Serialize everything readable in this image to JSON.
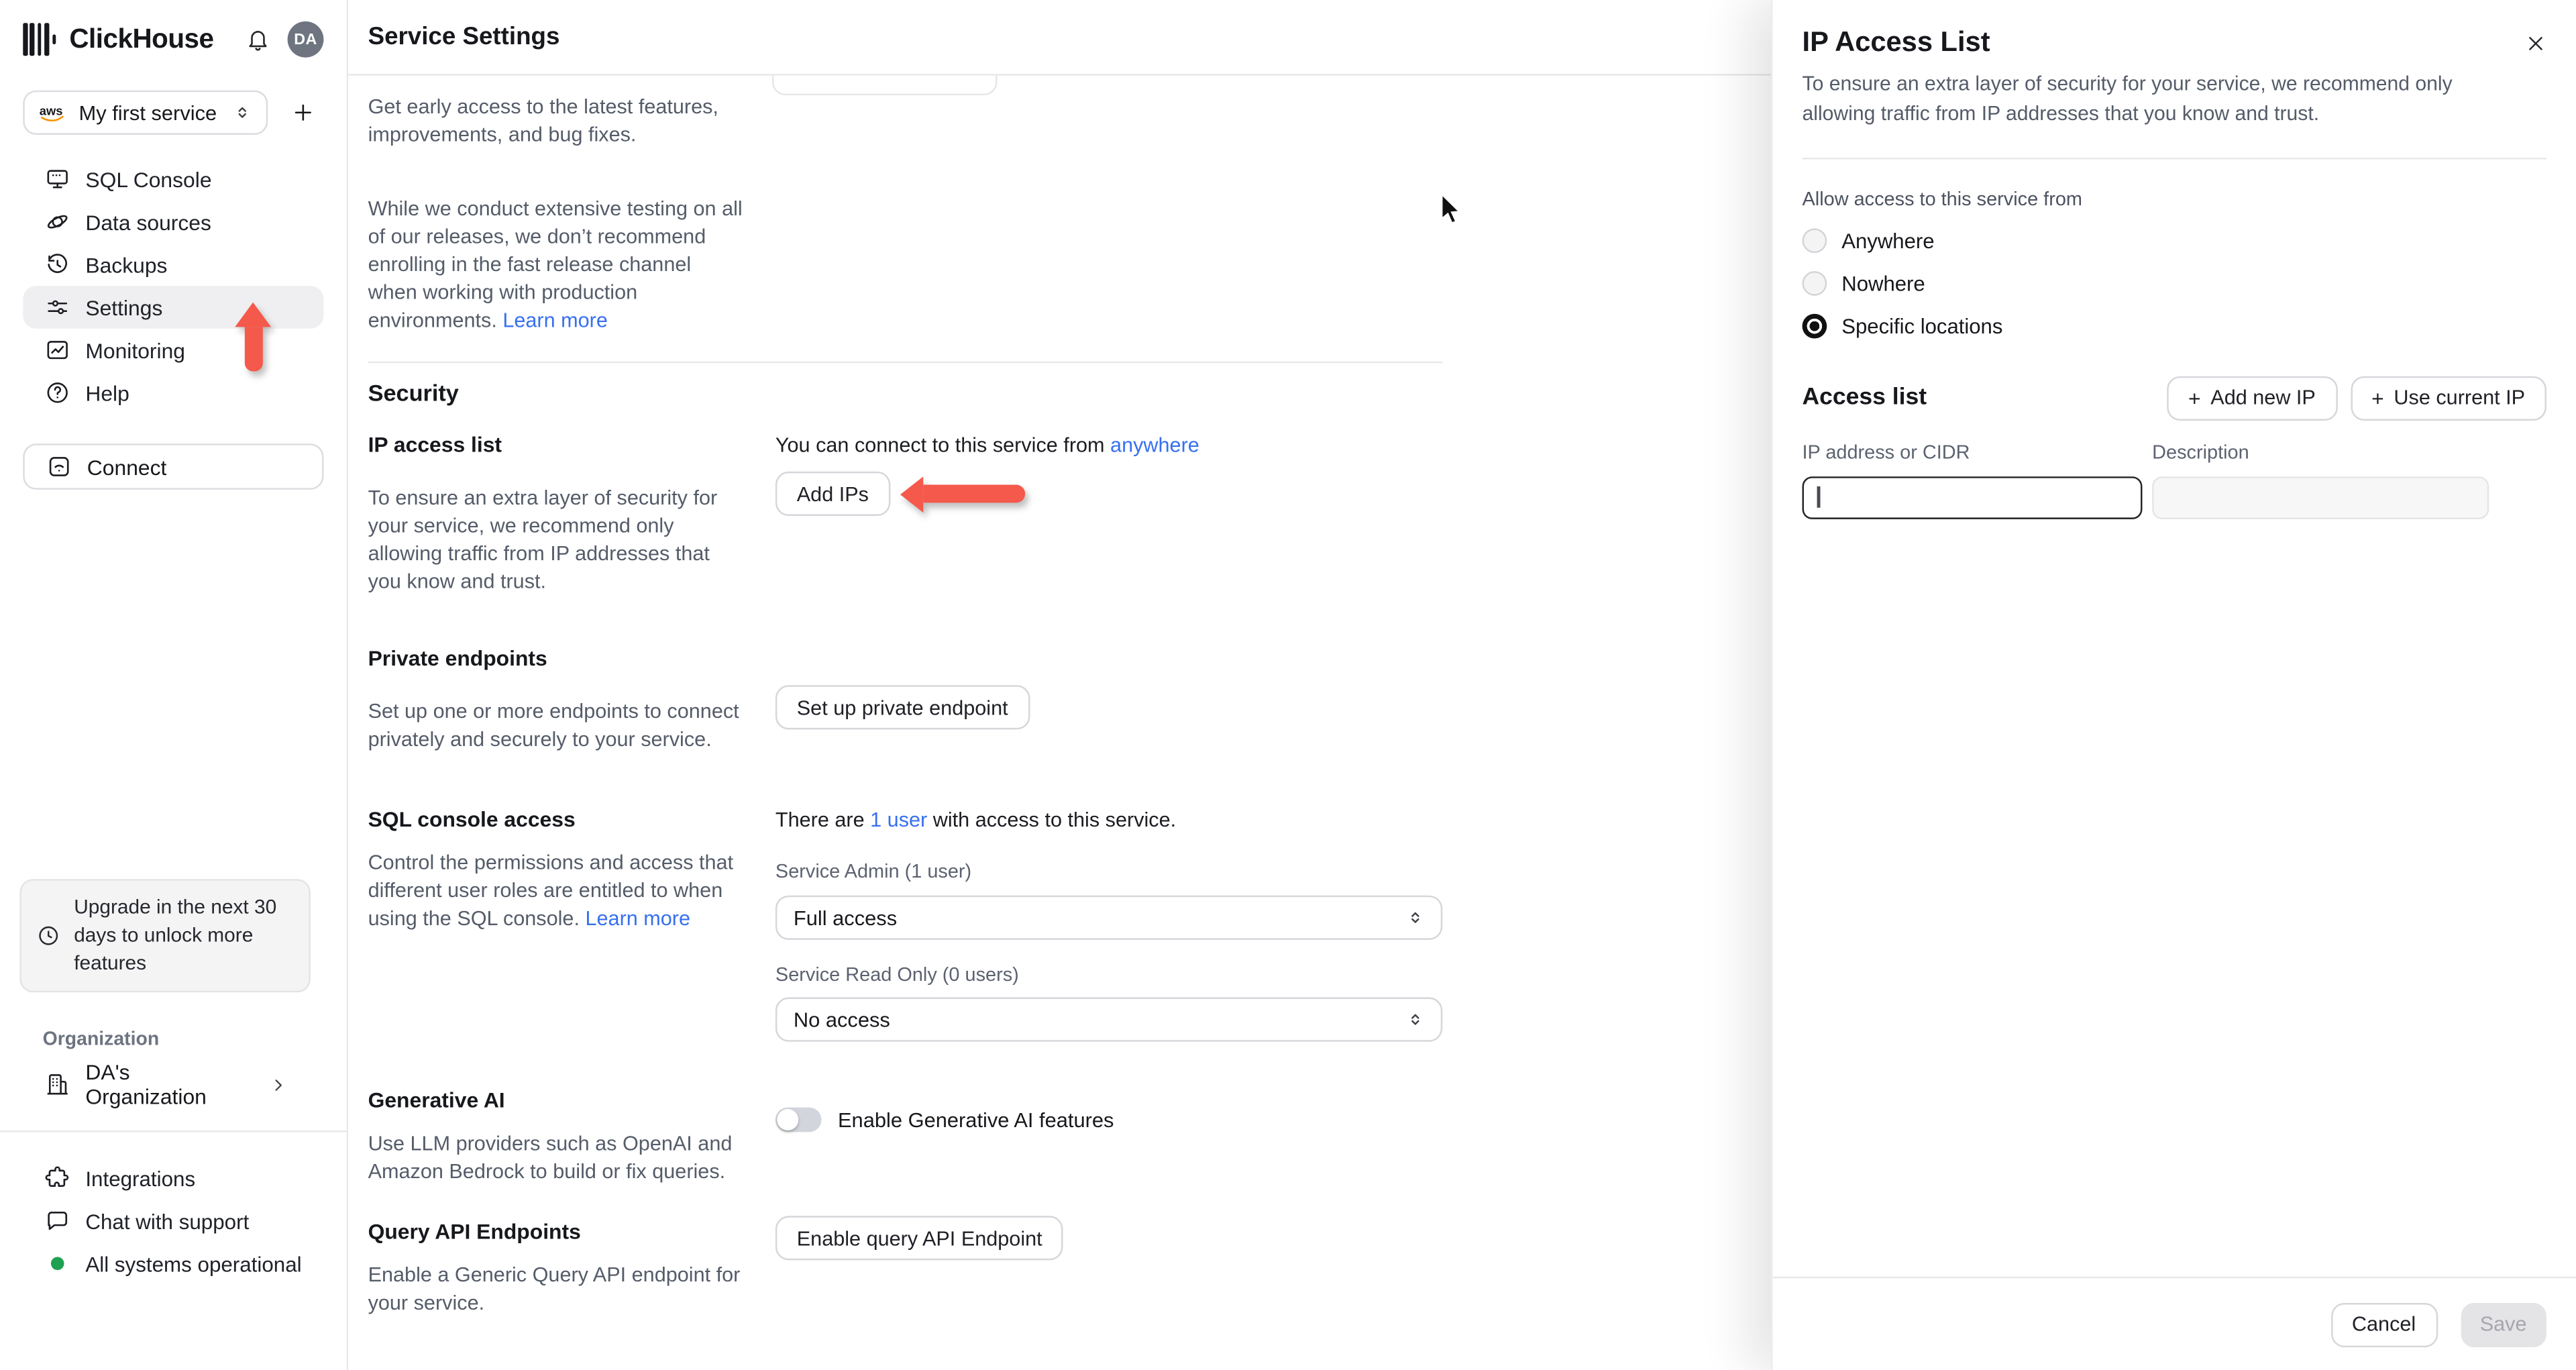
{
  "colors": {
    "accent_red": "#F4594C",
    "link_blue": "#3770EF",
    "status_green": "#1FA152"
  },
  "sidebar": {
    "brand": "ClickHouse",
    "avatar_initials": "DA",
    "service_selector": {
      "provider": "aws",
      "label": "My first service"
    },
    "add_service_label": "+",
    "nav": [
      {
        "label": "SQL Console"
      },
      {
        "label": "Data sources"
      },
      {
        "label": "Backups"
      },
      {
        "label": "Settings"
      },
      {
        "label": "Monitoring"
      },
      {
        "label": "Help"
      }
    ],
    "connect_label": "Connect",
    "upgrade_notice": "Upgrade in the next 30 days to unlock more features",
    "organization_label": "Organization",
    "organization_name": "DA's Organization",
    "footer_items": [
      {
        "label": "Integrations"
      },
      {
        "label": "Chat with support"
      },
      {
        "label": "All systems operational"
      }
    ]
  },
  "main": {
    "header_title": "Service Settings",
    "fast_release": {
      "p1": "Get early access to the latest features, improvements, and bug fixes.",
      "p2": "While we conduct extensive testing on all of our releases, we don’t recommend enrolling in the fast release channel when working with production environments. ",
      "learn_more": "Learn more"
    },
    "security_heading": "Security",
    "ip_access": {
      "title": "IP access list",
      "description": "To ensure an extra layer of security for your service, we recommend only allowing traffic from IP addresses that you know and trust.",
      "connect_prefix": "You can connect to this service from ",
      "connect_link": "anywhere",
      "add_ips_button": "Add IPs"
    },
    "private_endpoints": {
      "title": "Private endpoints",
      "description": "Set up one or more endpoints to connect privately and securely to your service.",
      "button": "Set up private endpoint"
    },
    "sql_access": {
      "title": "SQL console access",
      "summary_prefix": "There are ",
      "summary_link": "1 user",
      "summary_suffix": " with access to this service.",
      "description": "Control the permissions and access that different user roles are entitled to when using the SQL console. ",
      "learn_more": "Learn more",
      "admin_label": "Service Admin (1 user)",
      "admin_value": "Full access",
      "readonly_label": "Service Read Only (0 users)",
      "readonly_value": "No access"
    },
    "generative_ai": {
      "title": "Generative AI",
      "description": "Use LLM providers such as OpenAI and Amazon Bedrock to build or fix queries.",
      "toggle_label": "Enable Generative AI features"
    },
    "query_api": {
      "title": "Query API Endpoints",
      "description": "Enable a Generic Query API endpoint for your service.",
      "button": "Enable query API Endpoint"
    }
  },
  "panel": {
    "title": "IP Access List",
    "description": "To ensure an extra layer of security for your service, we recommend only allowing traffic from IP addresses that you know and trust.",
    "allow_label": "Allow access to this service from",
    "options": [
      {
        "label": "Anywhere",
        "selected": false
      },
      {
        "label": "Nowhere",
        "selected": false
      },
      {
        "label": "Specific locations",
        "selected": true
      }
    ],
    "access_list": {
      "heading": "Access list",
      "plus": "+",
      "add_new_ip": "Add new IP",
      "use_current_ip": "Use current IP",
      "ip_label": "IP address or CIDR",
      "description_label": "Description",
      "ip_value": "",
      "description_value": ""
    },
    "footer": {
      "cancel": "Cancel",
      "save": "Save"
    }
  }
}
